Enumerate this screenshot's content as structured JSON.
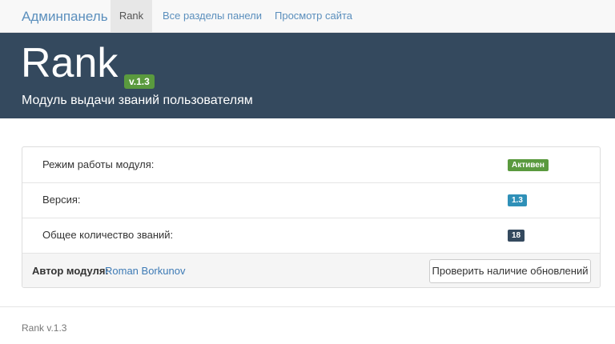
{
  "nav": {
    "brand": "Админпанель",
    "items": [
      {
        "label": "Rank",
        "active": true
      },
      {
        "label": "Все разделы панели",
        "active": false
      },
      {
        "label": "Просмотр сайта",
        "active": false
      }
    ]
  },
  "hero": {
    "title": "Rank",
    "version": "v.1.3",
    "subtitle": "Модуль выдачи званий пользователям"
  },
  "panel": {
    "rows": [
      {
        "label": "Режим работы модуля:",
        "badge": "Активен",
        "badge_color": "#5a9a3e"
      },
      {
        "label": "Версия:",
        "badge": "1.3",
        "badge_color": "#2f90b8"
      },
      {
        "label": "Общее количество званий:",
        "badge": "18",
        "badge_color": "#34495e"
      }
    ],
    "author_label": "Автор модуля:",
    "author_name": "Roman Borkunov",
    "update_button": "Проверить наличие обновлений"
  },
  "footer": {
    "text": "Rank v.1.3"
  }
}
